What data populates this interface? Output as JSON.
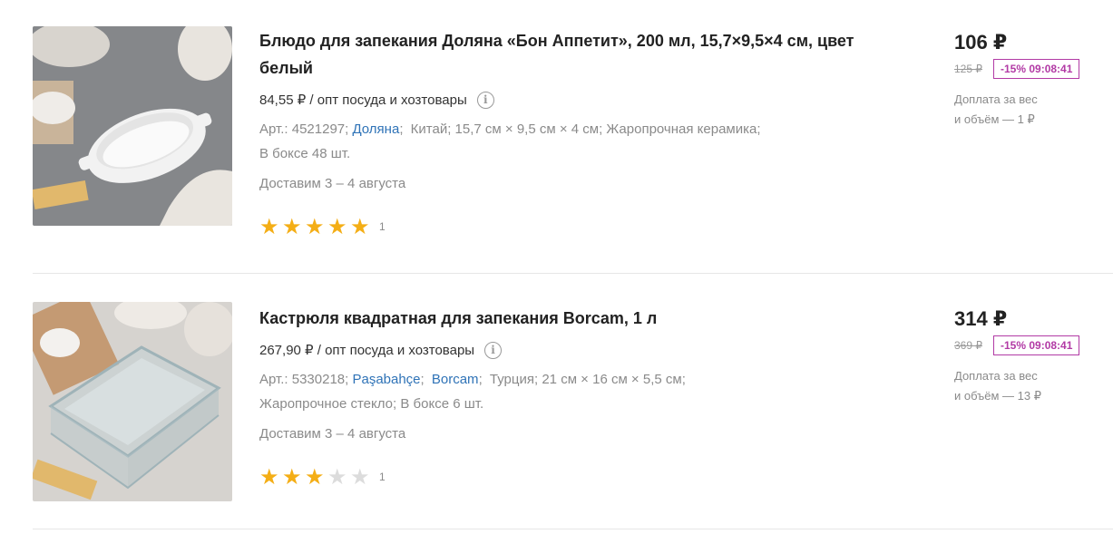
{
  "products": [
    {
      "title_line1": "Блюдо для запекания Доляна «Бон Аппетит», 200 мл, 15,7×9,5×4 см, цвет",
      "title_line2": "белый",
      "unit_price": "84,55 ₽ / опт посуда и хозтовары",
      "info_icon": "info-icon",
      "specs": {
        "article": "Арт.: 4521297;",
        "brand": "Доляна",
        "brand_sep": ";",
        "country": "Китай;",
        "size": "15,7 см × 9,5 см × 4 см;",
        "material": "Жаропрочная керамика;",
        "box": "В боксе 48 шт."
      },
      "delivery": "Доставим 3 – 4 августа",
      "rating": 5,
      "rating_max": 5,
      "review_count": "1",
      "price": "106 ₽",
      "old_price": "125 ₽",
      "discount": "-15% 09:08:41",
      "surcharge_line1": "Доплата за вес",
      "surcharge_line2": "и объём — 1 ₽"
    },
    {
      "title_line1": "Кастрюля квадратная для запекания Borcam, 1 л",
      "unit_price": "267,90 ₽ / опт посуда и хозтовары",
      "info_icon": "info-icon",
      "specs": {
        "article": "Арт.: 5330218;",
        "brand1": "Paşabahçe",
        "brand1_sep": ";",
        "brand2": "Borcam",
        "brand2_sep": ";",
        "country": "Турция;",
        "size": "21 см × 16 см × 5,5 см;",
        "material": "Жаропрочное стекло;",
        "box": "В боксе 6 шт."
      },
      "delivery": "Доставим 3 – 4 августа",
      "rating": 3,
      "rating_max": 5,
      "review_count": "1",
      "price": "314 ₽",
      "old_price": "369 ₽",
      "discount": "-15% 09:08:41",
      "surcharge_line1": "Доплата за вес",
      "surcharge_line2": "и объём — 13 ₽"
    }
  ],
  "colors": {
    "star_on": "#f4ae16",
    "star_off": "#dcdcdc",
    "link": "#2f73b7",
    "discount": "#b23aa5"
  },
  "icons": {
    "info": "i",
    "star": "★"
  }
}
